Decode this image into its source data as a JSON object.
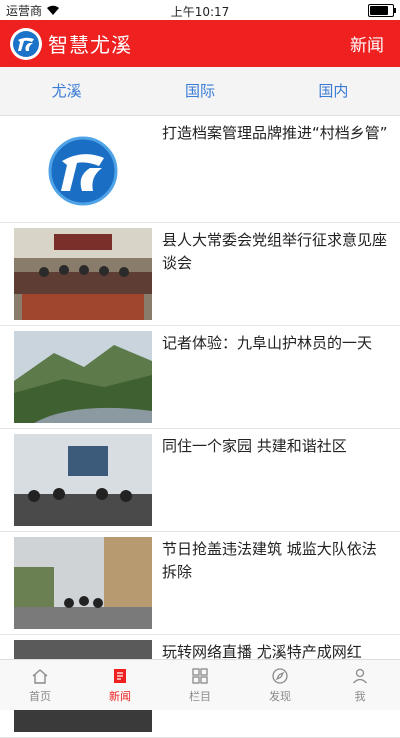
{
  "status": {
    "carrier": "运营商",
    "time": "上午10:17",
    "battery_level": 0.9
  },
  "header": {
    "title": "智慧尤溪",
    "right_label": "新闻"
  },
  "tabs": [
    {
      "label": "尤溪"
    },
    {
      "label": "国际"
    },
    {
      "label": "国内"
    }
  ],
  "news": [
    {
      "title": "打造档案管理品牌推进“村档乡管”"
    },
    {
      "title": "县人大常委会党组举行征求意见座谈会"
    },
    {
      "title": "记者体验：九阜山护林员的一天"
    },
    {
      "title": "同住一个家园 共建和谐社区"
    },
    {
      "title": "节日抢盖违法建筑 城监大队依法拆除"
    },
    {
      "title": "玩转网络直播 尤溪特产成网红"
    }
  ],
  "tabbar": [
    {
      "label": "首页",
      "icon": "home-icon"
    },
    {
      "label": "新闻",
      "icon": "news-icon",
      "active": true
    },
    {
      "label": "栏目",
      "icon": "grid-icon"
    },
    {
      "label": "发现",
      "icon": "compass-icon"
    },
    {
      "label": "我",
      "icon": "person-icon"
    }
  ],
  "colors": {
    "accent": "#ef2020",
    "tab_text": "#3a7bd5"
  }
}
